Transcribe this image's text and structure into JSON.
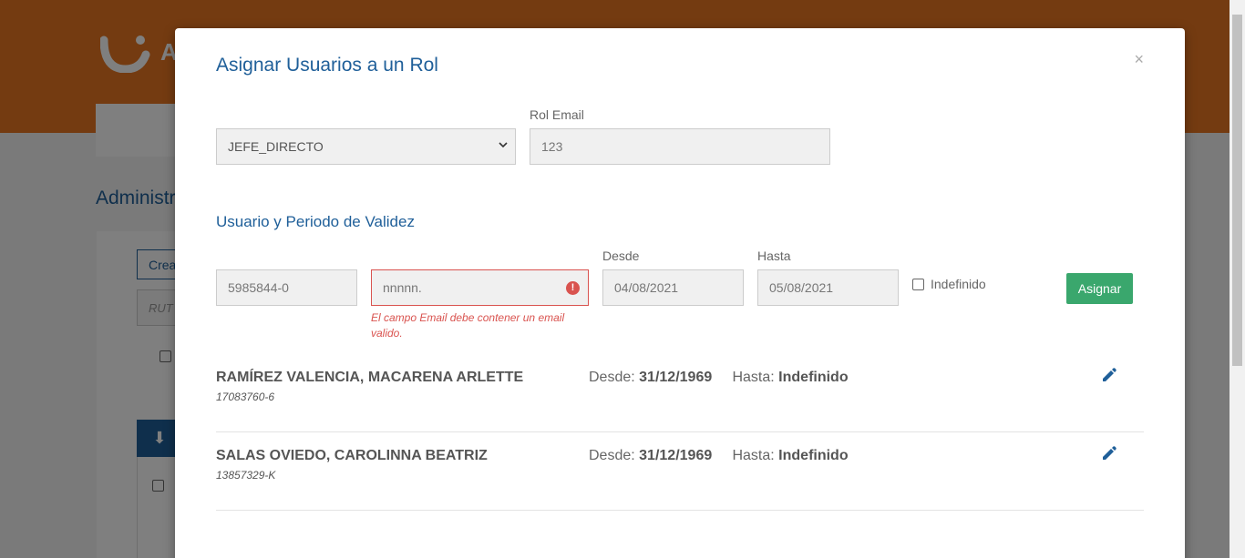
{
  "background": {
    "logo_letter": "A",
    "title": "Administr",
    "create_button": "Crea",
    "rut_placeholder": "RUT",
    "download_icon": "arrow-down-icon"
  },
  "modal": {
    "title": "Asignar Usuarios a un Rol",
    "close_label": "×",
    "role_select_value": "JEFE_DIRECTO",
    "rol_email_label": "Rol Email",
    "rol_email_value": "123",
    "section_title": "Usuario y Periodo de Validez",
    "rut_value": "5985844-0",
    "email_value": "nnnnn.",
    "email_error_icon": "!",
    "email_error": "El campo Email debe contener un email valido.",
    "desde_label": "Desde",
    "desde_value": "04/08/2021",
    "hasta_label": "Hasta",
    "hasta_value": "05/08/2021",
    "indefinido_label": "Indefinido",
    "assign_button": "Asignar"
  },
  "users": [
    {
      "name": "RAMÍREZ VALENCIA, MACARENA ARLETTE",
      "rut": "17083760-6",
      "desde_label": "Desde:",
      "desde": "31/12/1969",
      "hasta_label": "Hasta:",
      "hasta": "Indefinido"
    },
    {
      "name": "SALAS OVIEDO, CAROLINNA BEATRIZ",
      "rut": "13857329-K",
      "desde_label": "Desde:",
      "desde": "31/12/1969",
      "hasta_label": "Hasta:",
      "hasta": "Indefinido"
    }
  ],
  "colors": {
    "header_orange": "#e87722",
    "primary_blue": "#1f5f99",
    "success_green": "#3aa76d",
    "error_red": "#d9534f"
  }
}
